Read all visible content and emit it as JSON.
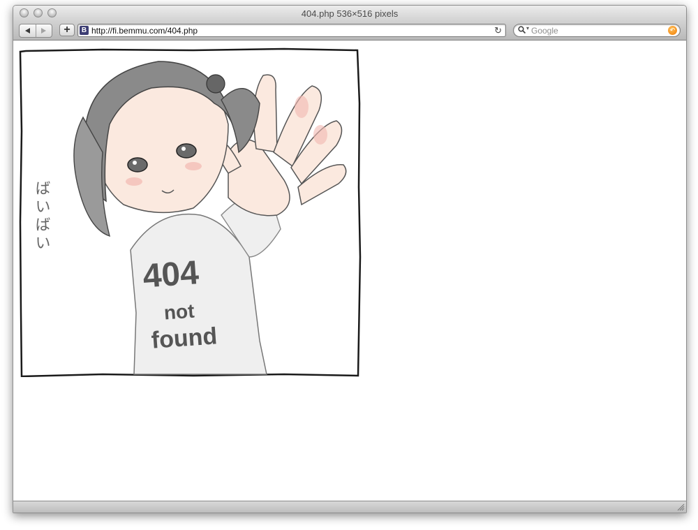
{
  "window": {
    "title": "404.php 536×516 pixels"
  },
  "toolbar": {
    "url": "http://fi.bemmu.com/404.php",
    "favicon_letter": "B",
    "search_placeholder": "Google",
    "icons": [
      "back-icon",
      "forward-icon",
      "add-bookmark-icon",
      "reload-icon",
      "search-icon",
      "snapback-icon"
    ]
  },
  "image": {
    "shirt_line1": "404",
    "shirt_line2": "not",
    "shirt_line3": "found",
    "side_text": "ばいばい",
    "colors": {
      "hair": "#8a8a8a",
      "skin": "#fbe9df",
      "blush": "#f2b8b0",
      "shirt": "#efefef",
      "frame": "#1a1a1a"
    }
  }
}
